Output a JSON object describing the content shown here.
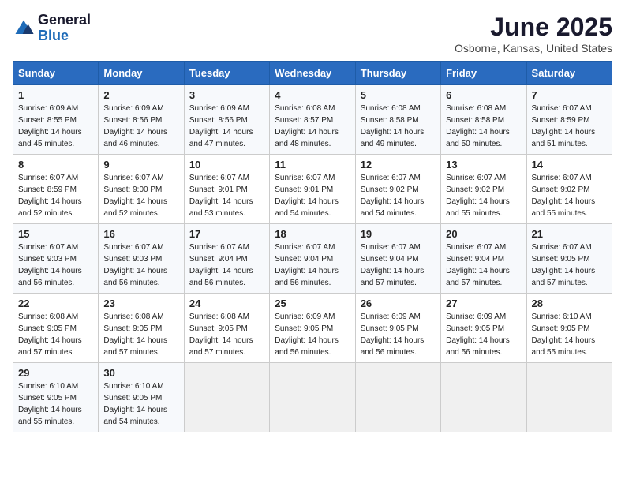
{
  "header": {
    "logo_line1": "General",
    "logo_line2": "Blue",
    "month_title": "June 2025",
    "location": "Osborne, Kansas, United States"
  },
  "weekdays": [
    "Sunday",
    "Monday",
    "Tuesday",
    "Wednesday",
    "Thursday",
    "Friday",
    "Saturday"
  ],
  "weeks": [
    [
      {
        "day": "1",
        "sunrise": "6:09 AM",
        "sunset": "8:55 PM",
        "daylight": "14 hours and 45 minutes."
      },
      {
        "day": "2",
        "sunrise": "6:09 AM",
        "sunset": "8:56 PM",
        "daylight": "14 hours and 46 minutes."
      },
      {
        "day": "3",
        "sunrise": "6:09 AM",
        "sunset": "8:56 PM",
        "daylight": "14 hours and 47 minutes."
      },
      {
        "day": "4",
        "sunrise": "6:08 AM",
        "sunset": "8:57 PM",
        "daylight": "14 hours and 48 minutes."
      },
      {
        "day": "5",
        "sunrise": "6:08 AM",
        "sunset": "8:58 PM",
        "daylight": "14 hours and 49 minutes."
      },
      {
        "day": "6",
        "sunrise": "6:08 AM",
        "sunset": "8:58 PM",
        "daylight": "14 hours and 50 minutes."
      },
      {
        "day": "7",
        "sunrise": "6:07 AM",
        "sunset": "8:59 PM",
        "daylight": "14 hours and 51 minutes."
      }
    ],
    [
      {
        "day": "8",
        "sunrise": "6:07 AM",
        "sunset": "8:59 PM",
        "daylight": "14 hours and 52 minutes."
      },
      {
        "day": "9",
        "sunrise": "6:07 AM",
        "sunset": "9:00 PM",
        "daylight": "14 hours and 52 minutes."
      },
      {
        "day": "10",
        "sunrise": "6:07 AM",
        "sunset": "9:01 PM",
        "daylight": "14 hours and 53 minutes."
      },
      {
        "day": "11",
        "sunrise": "6:07 AM",
        "sunset": "9:01 PM",
        "daylight": "14 hours and 54 minutes."
      },
      {
        "day": "12",
        "sunrise": "6:07 AM",
        "sunset": "9:02 PM",
        "daylight": "14 hours and 54 minutes."
      },
      {
        "day": "13",
        "sunrise": "6:07 AM",
        "sunset": "9:02 PM",
        "daylight": "14 hours and 55 minutes."
      },
      {
        "day": "14",
        "sunrise": "6:07 AM",
        "sunset": "9:02 PM",
        "daylight": "14 hours and 55 minutes."
      }
    ],
    [
      {
        "day": "15",
        "sunrise": "6:07 AM",
        "sunset": "9:03 PM",
        "daylight": "14 hours and 56 minutes."
      },
      {
        "day": "16",
        "sunrise": "6:07 AM",
        "sunset": "9:03 PM",
        "daylight": "14 hours and 56 minutes."
      },
      {
        "day": "17",
        "sunrise": "6:07 AM",
        "sunset": "9:04 PM",
        "daylight": "14 hours and 56 minutes."
      },
      {
        "day": "18",
        "sunrise": "6:07 AM",
        "sunset": "9:04 PM",
        "daylight": "14 hours and 56 minutes."
      },
      {
        "day": "19",
        "sunrise": "6:07 AM",
        "sunset": "9:04 PM",
        "daylight": "14 hours and 57 minutes."
      },
      {
        "day": "20",
        "sunrise": "6:07 AM",
        "sunset": "9:04 PM",
        "daylight": "14 hours and 57 minutes."
      },
      {
        "day": "21",
        "sunrise": "6:07 AM",
        "sunset": "9:05 PM",
        "daylight": "14 hours and 57 minutes."
      }
    ],
    [
      {
        "day": "22",
        "sunrise": "6:08 AM",
        "sunset": "9:05 PM",
        "daylight": "14 hours and 57 minutes."
      },
      {
        "day": "23",
        "sunrise": "6:08 AM",
        "sunset": "9:05 PM",
        "daylight": "14 hours and 57 minutes."
      },
      {
        "day": "24",
        "sunrise": "6:08 AM",
        "sunset": "9:05 PM",
        "daylight": "14 hours and 57 minutes."
      },
      {
        "day": "25",
        "sunrise": "6:09 AM",
        "sunset": "9:05 PM",
        "daylight": "14 hours and 56 minutes."
      },
      {
        "day": "26",
        "sunrise": "6:09 AM",
        "sunset": "9:05 PM",
        "daylight": "14 hours and 56 minutes."
      },
      {
        "day": "27",
        "sunrise": "6:09 AM",
        "sunset": "9:05 PM",
        "daylight": "14 hours and 56 minutes."
      },
      {
        "day": "28",
        "sunrise": "6:10 AM",
        "sunset": "9:05 PM",
        "daylight": "14 hours and 55 minutes."
      }
    ],
    [
      {
        "day": "29",
        "sunrise": "6:10 AM",
        "sunset": "9:05 PM",
        "daylight": "14 hours and 55 minutes."
      },
      {
        "day": "30",
        "sunrise": "6:10 AM",
        "sunset": "9:05 PM",
        "daylight": "14 hours and 54 minutes."
      },
      null,
      null,
      null,
      null,
      null
    ]
  ]
}
